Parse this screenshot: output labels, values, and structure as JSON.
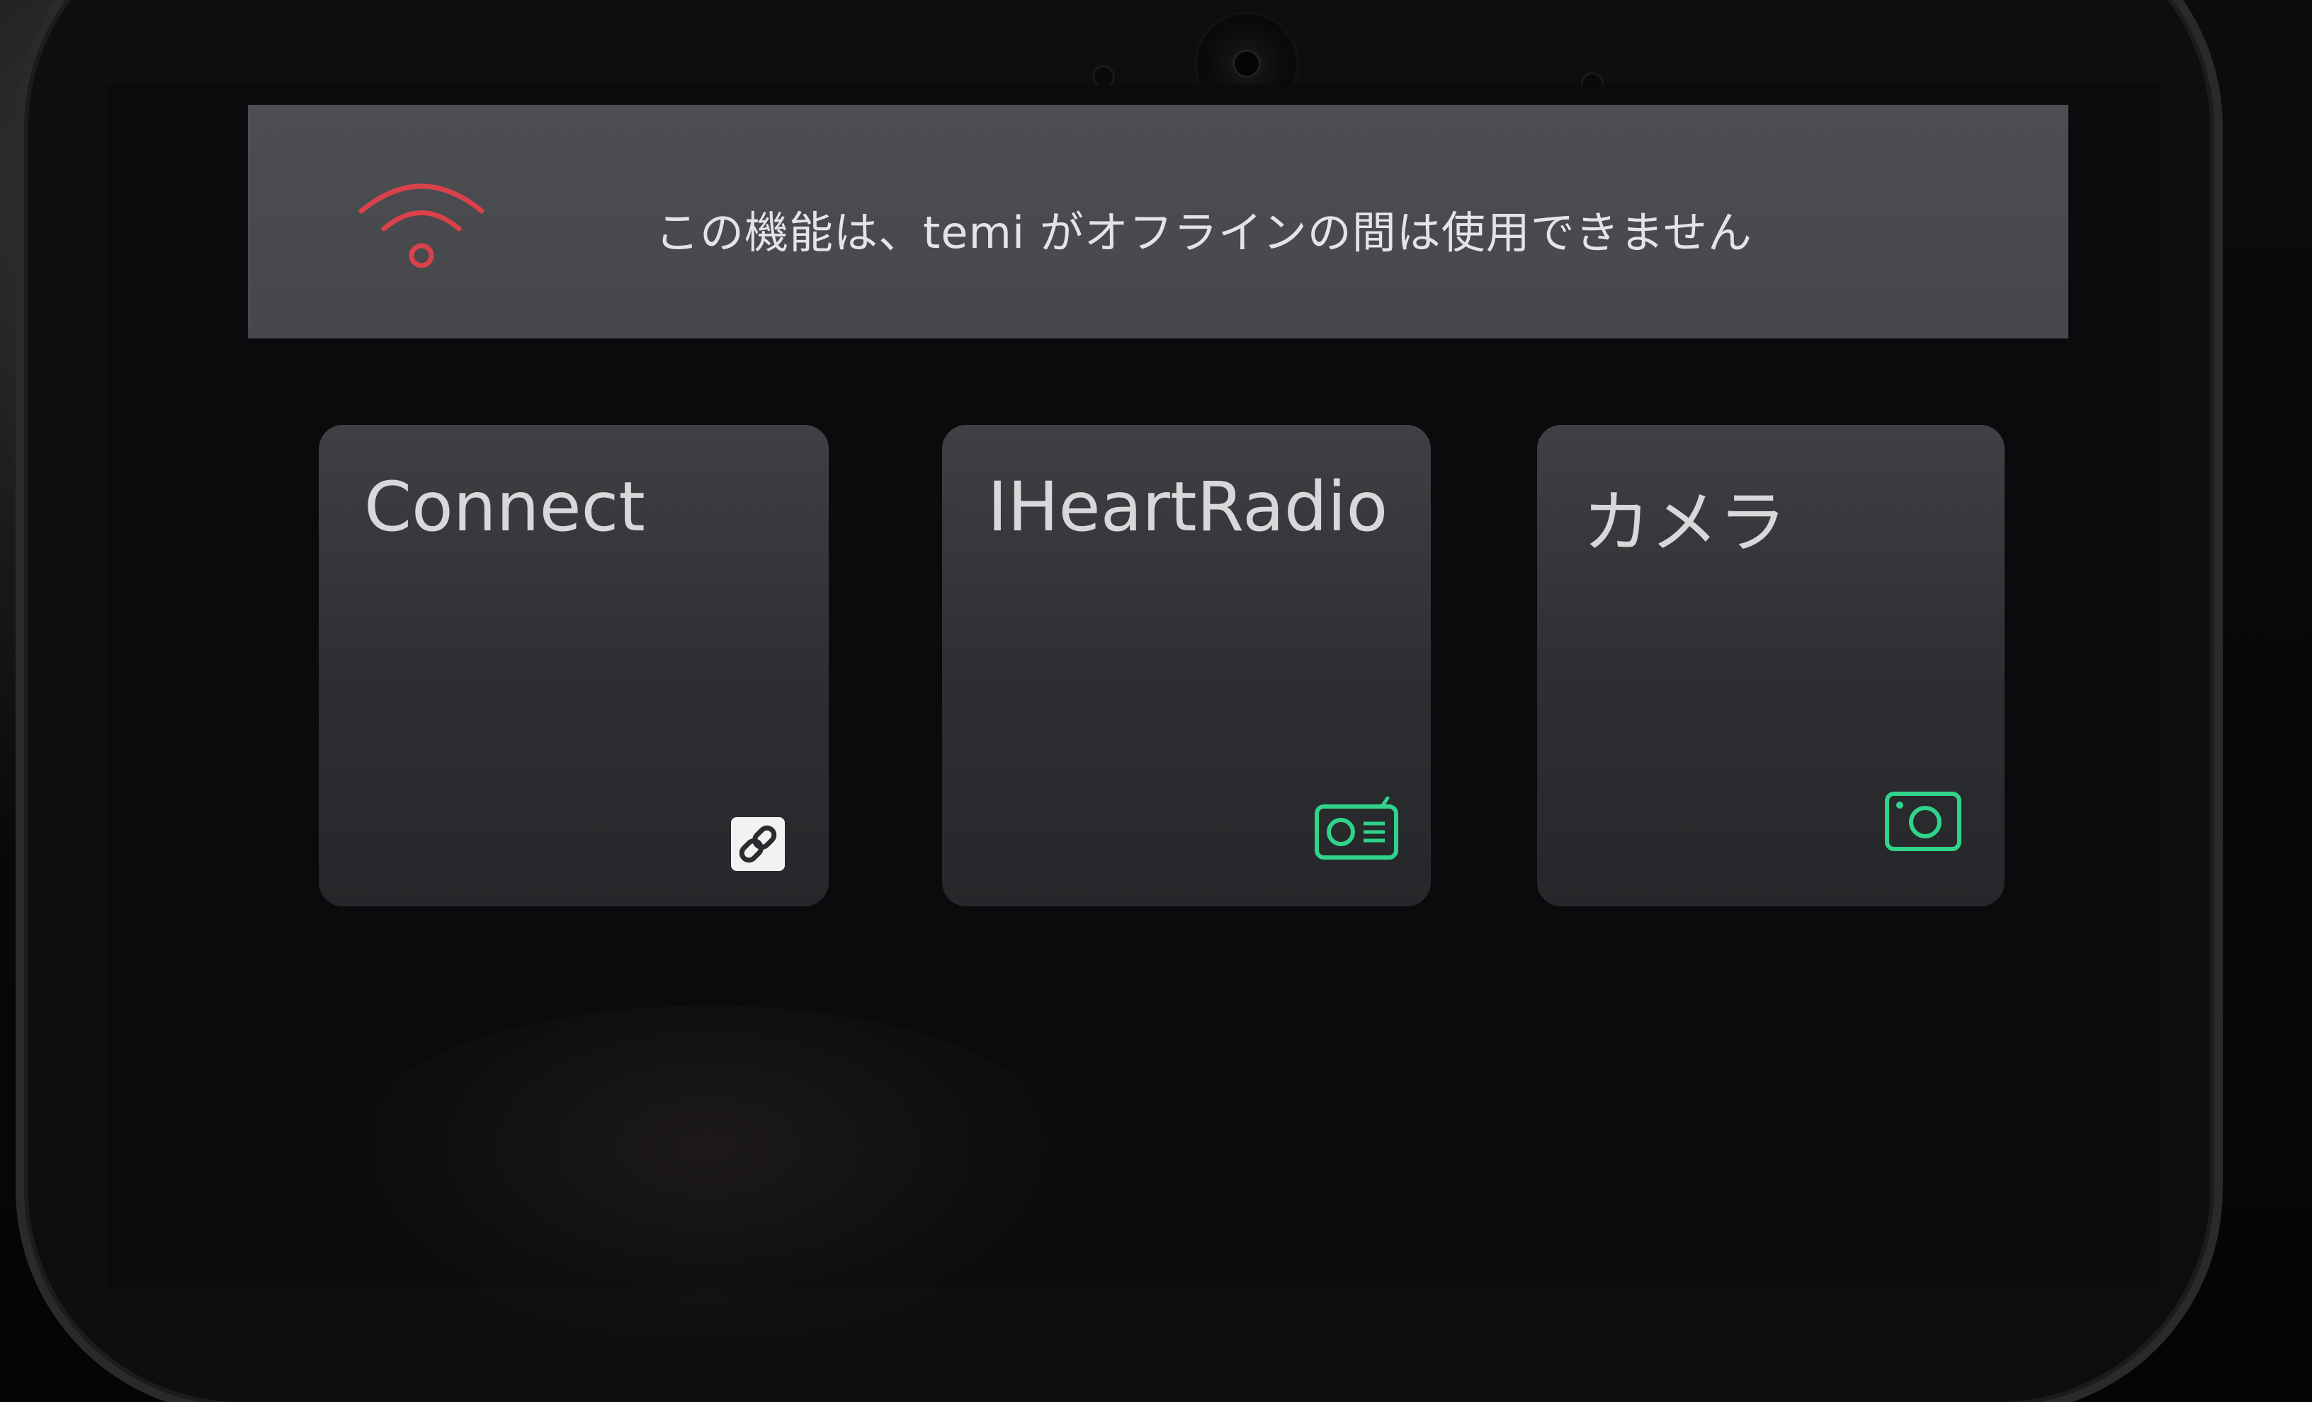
{
  "banner": {
    "message": "この機能は、temi がオフラインの間は使用できません",
    "icon": "wifi-offline-icon",
    "icon_color": "#d9424a"
  },
  "tiles": [
    {
      "title": "Connect",
      "icon": "link-icon",
      "icon_color": "#ffffff"
    },
    {
      "title": "IHeartRadio",
      "icon": "radio-icon",
      "icon_color": "#2fd48a"
    },
    {
      "title": "カメラ",
      "icon": "camera-icon",
      "icon_color": "#2fd48a"
    }
  ],
  "colors": {
    "banner_bg": "#4a4c50",
    "tile_bg": "#34363a",
    "accent_green": "#2fd48a",
    "offline_red": "#d9424a"
  }
}
